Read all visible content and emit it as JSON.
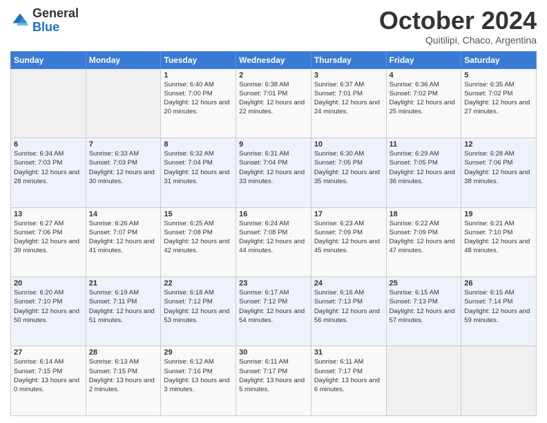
{
  "header": {
    "logo": {
      "general": "General",
      "blue": "Blue"
    },
    "title": "October 2024",
    "subtitle": "Quitilipi, Chaco, Argentina"
  },
  "days_of_week": [
    "Sunday",
    "Monday",
    "Tuesday",
    "Wednesday",
    "Thursday",
    "Friday",
    "Saturday"
  ],
  "weeks": [
    [
      {
        "day": "",
        "sunrise": "",
        "sunset": "",
        "daylight": ""
      },
      {
        "day": "",
        "sunrise": "",
        "sunset": "",
        "daylight": ""
      },
      {
        "day": "1",
        "sunrise": "Sunrise: 6:40 AM",
        "sunset": "Sunset: 7:00 PM",
        "daylight": "Daylight: 12 hours and 20 minutes."
      },
      {
        "day": "2",
        "sunrise": "Sunrise: 6:38 AM",
        "sunset": "Sunset: 7:01 PM",
        "daylight": "Daylight: 12 hours and 22 minutes."
      },
      {
        "day": "3",
        "sunrise": "Sunrise: 6:37 AM",
        "sunset": "Sunset: 7:01 PM",
        "daylight": "Daylight: 12 hours and 24 minutes."
      },
      {
        "day": "4",
        "sunrise": "Sunrise: 6:36 AM",
        "sunset": "Sunset: 7:02 PM",
        "daylight": "Daylight: 12 hours and 25 minutes."
      },
      {
        "day": "5",
        "sunrise": "Sunrise: 6:35 AM",
        "sunset": "Sunset: 7:02 PM",
        "daylight": "Daylight: 12 hours and 27 minutes."
      }
    ],
    [
      {
        "day": "6",
        "sunrise": "Sunrise: 6:34 AM",
        "sunset": "Sunset: 7:03 PM",
        "daylight": "Daylight: 12 hours and 28 minutes."
      },
      {
        "day": "7",
        "sunrise": "Sunrise: 6:33 AM",
        "sunset": "Sunset: 7:03 PM",
        "daylight": "Daylight: 12 hours and 30 minutes."
      },
      {
        "day": "8",
        "sunrise": "Sunrise: 6:32 AM",
        "sunset": "Sunset: 7:04 PM",
        "daylight": "Daylight: 12 hours and 31 minutes."
      },
      {
        "day": "9",
        "sunrise": "Sunrise: 6:31 AM",
        "sunset": "Sunset: 7:04 PM",
        "daylight": "Daylight: 12 hours and 33 minutes."
      },
      {
        "day": "10",
        "sunrise": "Sunrise: 6:30 AM",
        "sunset": "Sunset: 7:05 PM",
        "daylight": "Daylight: 12 hours and 35 minutes."
      },
      {
        "day": "11",
        "sunrise": "Sunrise: 6:29 AM",
        "sunset": "Sunset: 7:05 PM",
        "daylight": "Daylight: 12 hours and 36 minutes."
      },
      {
        "day": "12",
        "sunrise": "Sunrise: 6:28 AM",
        "sunset": "Sunset: 7:06 PM",
        "daylight": "Daylight: 12 hours and 38 minutes."
      }
    ],
    [
      {
        "day": "13",
        "sunrise": "Sunrise: 6:27 AM",
        "sunset": "Sunset: 7:06 PM",
        "daylight": "Daylight: 12 hours and 39 minutes."
      },
      {
        "day": "14",
        "sunrise": "Sunrise: 6:26 AM",
        "sunset": "Sunset: 7:07 PM",
        "daylight": "Daylight: 12 hours and 41 minutes."
      },
      {
        "day": "15",
        "sunrise": "Sunrise: 6:25 AM",
        "sunset": "Sunset: 7:08 PM",
        "daylight": "Daylight: 12 hours and 42 minutes."
      },
      {
        "day": "16",
        "sunrise": "Sunrise: 6:24 AM",
        "sunset": "Sunset: 7:08 PM",
        "daylight": "Daylight: 12 hours and 44 minutes."
      },
      {
        "day": "17",
        "sunrise": "Sunrise: 6:23 AM",
        "sunset": "Sunset: 7:09 PM",
        "daylight": "Daylight: 12 hours and 45 minutes."
      },
      {
        "day": "18",
        "sunrise": "Sunrise: 6:22 AM",
        "sunset": "Sunset: 7:09 PM",
        "daylight": "Daylight: 12 hours and 47 minutes."
      },
      {
        "day": "19",
        "sunrise": "Sunrise: 6:21 AM",
        "sunset": "Sunset: 7:10 PM",
        "daylight": "Daylight: 12 hours and 48 minutes."
      }
    ],
    [
      {
        "day": "20",
        "sunrise": "Sunrise: 6:20 AM",
        "sunset": "Sunset: 7:10 PM",
        "daylight": "Daylight: 12 hours and 50 minutes."
      },
      {
        "day": "21",
        "sunrise": "Sunrise: 6:19 AM",
        "sunset": "Sunset: 7:11 PM",
        "daylight": "Daylight: 12 hours and 51 minutes."
      },
      {
        "day": "22",
        "sunrise": "Sunrise: 6:18 AM",
        "sunset": "Sunset: 7:12 PM",
        "daylight": "Daylight: 12 hours and 53 minutes."
      },
      {
        "day": "23",
        "sunrise": "Sunrise: 6:17 AM",
        "sunset": "Sunset: 7:12 PM",
        "daylight": "Daylight: 12 hours and 54 minutes."
      },
      {
        "day": "24",
        "sunrise": "Sunrise: 6:16 AM",
        "sunset": "Sunset: 7:13 PM",
        "daylight": "Daylight: 12 hours and 56 minutes."
      },
      {
        "day": "25",
        "sunrise": "Sunrise: 6:15 AM",
        "sunset": "Sunset: 7:13 PM",
        "daylight": "Daylight: 12 hours and 57 minutes."
      },
      {
        "day": "26",
        "sunrise": "Sunrise: 6:15 AM",
        "sunset": "Sunset: 7:14 PM",
        "daylight": "Daylight: 12 hours and 59 minutes."
      }
    ],
    [
      {
        "day": "27",
        "sunrise": "Sunrise: 6:14 AM",
        "sunset": "Sunset: 7:15 PM",
        "daylight": "Daylight: 13 hours and 0 minutes."
      },
      {
        "day": "28",
        "sunrise": "Sunrise: 6:13 AM",
        "sunset": "Sunset: 7:15 PM",
        "daylight": "Daylight: 13 hours and 2 minutes."
      },
      {
        "day": "29",
        "sunrise": "Sunrise: 6:12 AM",
        "sunset": "Sunset: 7:16 PM",
        "daylight": "Daylight: 13 hours and 3 minutes."
      },
      {
        "day": "30",
        "sunrise": "Sunrise: 6:11 AM",
        "sunset": "Sunset: 7:17 PM",
        "daylight": "Daylight: 13 hours and 5 minutes."
      },
      {
        "day": "31",
        "sunrise": "Sunrise: 6:11 AM",
        "sunset": "Sunset: 7:17 PM",
        "daylight": "Daylight: 13 hours and 6 minutes."
      },
      {
        "day": "",
        "sunrise": "",
        "sunset": "",
        "daylight": ""
      },
      {
        "day": "",
        "sunrise": "",
        "sunset": "",
        "daylight": ""
      }
    ]
  ]
}
